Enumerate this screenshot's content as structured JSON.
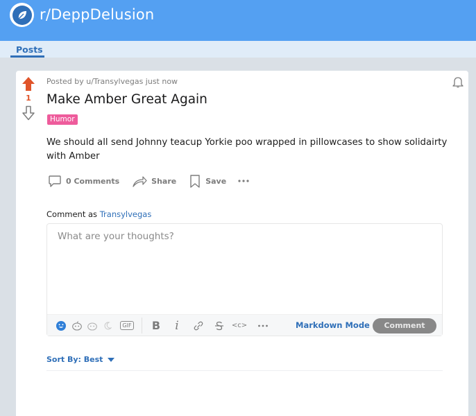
{
  "header": {
    "subreddit": "r/DeppDelusion"
  },
  "tabs": {
    "posts": "Posts"
  },
  "post": {
    "score": "1",
    "meta": "Posted by u/Transylvegas just now",
    "title": "Make Amber Great Again",
    "flair": "Humor",
    "body": "We should all send Johnny teacup Yorkie poo wrapped in pillowcases to show solidairty with Amber",
    "actions": {
      "comments": "0 Comments",
      "share": "Share",
      "save": "Save"
    }
  },
  "comment_box": {
    "label": "Comment as",
    "user": "Transylvegas",
    "placeholder": "What are your thoughts?",
    "markdown_mode": "Markdown Mode",
    "submit": "Comment",
    "toolbar": {
      "gif": "GIF",
      "bold": "B",
      "italic": "i",
      "code": "<c>"
    }
  },
  "sort": {
    "label": "Sort By: Best"
  },
  "colors": {
    "accent": "#2f6fb8",
    "header": "#54a0f2",
    "upvote": "#e0542a",
    "flair": "#ee5c9c"
  }
}
